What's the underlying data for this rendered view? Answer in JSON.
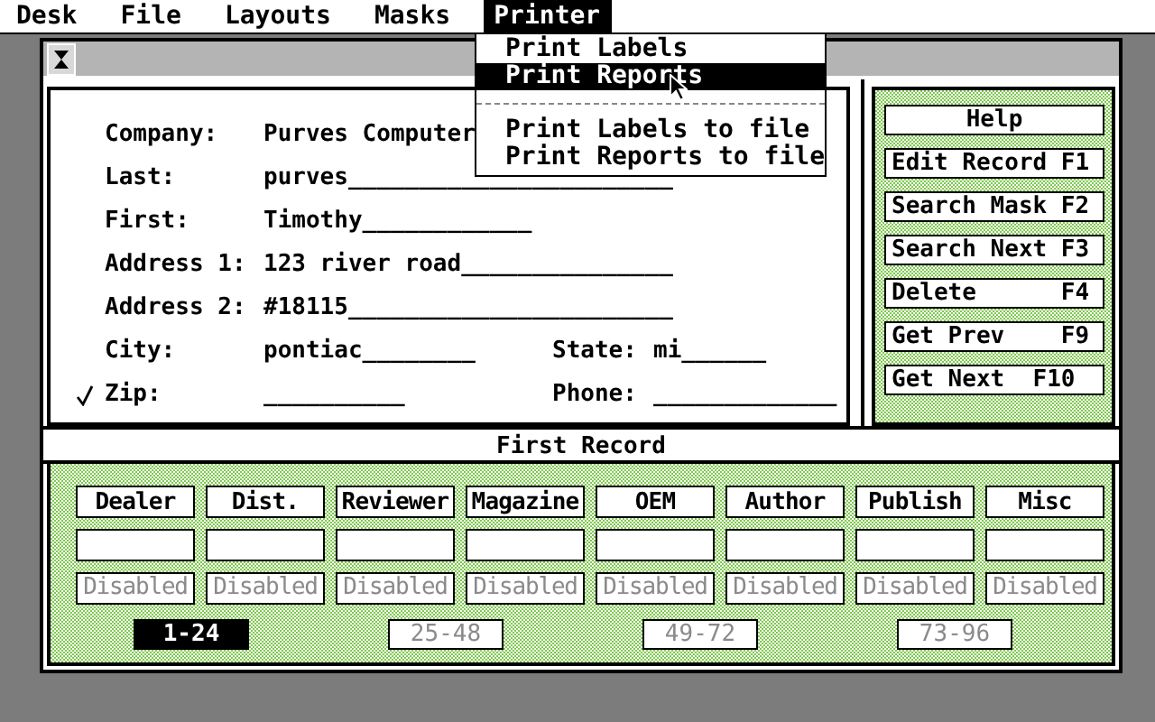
{
  "menubar": [
    {
      "label": "Desk",
      "selected": false
    },
    {
      "label": "File",
      "selected": false
    },
    {
      "label": "Layouts",
      "selected": false
    },
    {
      "label": "Masks",
      "selected": false
    },
    {
      "label": "Printer",
      "selected": true
    }
  ],
  "menu": {
    "items": [
      {
        "kind": "item",
        "label": "Print Labels",
        "selected": false
      },
      {
        "kind": "item",
        "label": "Print Reports",
        "selected": true
      },
      {
        "kind": "separator"
      },
      {
        "kind": "item",
        "label": "Print Labels to file",
        "selected": false
      },
      {
        "kind": "item",
        "label": "Print Reports to file",
        "selected": false
      }
    ]
  },
  "form": {
    "fields": [
      {
        "label": "Company:",
        "value": "Purves Computer",
        "checked": false
      },
      {
        "label": "Last:",
        "value": "purves_______________________",
        "checked": false
      },
      {
        "label": "First:",
        "value": "Timothy____________",
        "checked": false
      },
      {
        "label": "Address 1:",
        "value": "123 river road_______________",
        "checked": false
      },
      {
        "label": "Address 2:",
        "value": "#18115_______________________",
        "checked": false
      },
      {
        "label": "City:",
        "value": "pontiac________",
        "checked": false,
        "side_label": "State:",
        "side_value": "mi______"
      },
      {
        "label": "Zip:",
        "value": "__________",
        "checked": true,
        "side_label": "Phone:",
        "side_value": "_____________"
      }
    ]
  },
  "actions": [
    "Help",
    "Edit Record F1",
    "Search Mask F2",
    "Search Next F3",
    "Delete      F4",
    "Get Prev    F9",
    "Get Next  F10"
  ],
  "status": "First Record",
  "categories": [
    {
      "label": "Dealer",
      "state": "Disabled",
      "disabled": true
    },
    {
      "label": "Dist.",
      "state": "Disabled",
      "disabled": true
    },
    {
      "label": "Reviewer",
      "state": "Disabled",
      "disabled": true
    },
    {
      "label": "Magazine",
      "state": "Disabled",
      "disabled": true
    },
    {
      "label": "OEM",
      "state": "Disabled",
      "disabled": true
    },
    {
      "label": "Author",
      "state": "Disabled",
      "disabled": true
    },
    {
      "label": "Publish",
      "state": "Disabled",
      "disabled": true
    },
    {
      "label": "Misc",
      "state": "Disabled",
      "disabled": true
    }
  ],
  "pages": [
    {
      "label": "1-24",
      "selected": true
    },
    {
      "label": "25-48",
      "selected": false
    },
    {
      "label": "49-72",
      "selected": false
    },
    {
      "label": "73-96",
      "selected": false
    }
  ]
}
